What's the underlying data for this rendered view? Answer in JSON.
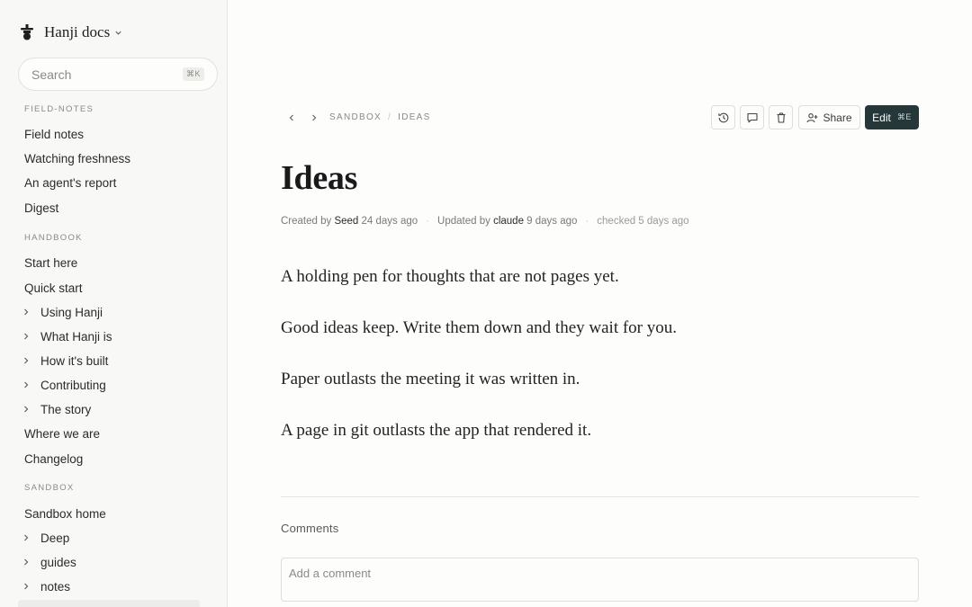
{
  "brand": {
    "title": "Hanji docs",
    "logo_icon": "hanji-logo-icon"
  },
  "search": {
    "placeholder": "Search",
    "shortcut": "⌘K"
  },
  "sidebar": {
    "sections": [
      {
        "title": "FIELD-NOTES",
        "items": [
          {
            "label": "Field notes",
            "expandable": false
          },
          {
            "label": "Watching freshness",
            "expandable": false
          },
          {
            "label": "An agent's report",
            "expandable": false
          },
          {
            "label": "Digest",
            "expandable": false
          }
        ]
      },
      {
        "title": "HANDBOOK",
        "items": [
          {
            "label": "Start here",
            "expandable": false
          },
          {
            "label": "Quick start",
            "expandable": false
          },
          {
            "label": "Using Hanji",
            "expandable": true
          },
          {
            "label": "What Hanji is",
            "expandable": true
          },
          {
            "label": "How it's built",
            "expandable": true
          },
          {
            "label": "Contributing",
            "expandable": true
          },
          {
            "label": "The story",
            "expandable": true
          },
          {
            "label": "Where we are",
            "expandable": false
          },
          {
            "label": "Changelog",
            "expandable": false
          }
        ]
      },
      {
        "title": "SANDBOX",
        "items": [
          {
            "label": "Sandbox home",
            "expandable": false
          },
          {
            "label": "Deep",
            "expandable": true
          },
          {
            "label": "guides",
            "expandable": true
          },
          {
            "label": "notes",
            "expandable": true
          }
        ]
      }
    ]
  },
  "breadcrumb": {
    "items": [
      "SANDBOX",
      "IDEAS"
    ],
    "separator": "/"
  },
  "toolbar": {
    "history_icon": "history-icon",
    "comment_icon": "comment-icon",
    "delete_icon": "trash-icon",
    "share_label": "Share",
    "edit_label": "Edit",
    "edit_shortcut": "⌘E"
  },
  "page": {
    "title": "Ideas",
    "meta": {
      "created_prefix": "Created by",
      "created_by": "Seed",
      "created_ago": "24 days ago",
      "updated_prefix": "Updated by",
      "updated_by": "claude",
      "updated_ago": "9 days ago",
      "checked": "checked 5 days ago"
    },
    "paragraphs": [
      "A holding pen for thoughts that are not pages yet.",
      "Good ideas keep. Write them down and they wait for you.",
      "Paper outlasts the meeting it was written in.",
      "A page in git outlasts the app that rendered it."
    ]
  },
  "comments": {
    "heading": "Comments",
    "placeholder": "Add a comment"
  },
  "colors": {
    "edit_button_bg": "#26373a",
    "sidebar_bg": "#f8f8f6",
    "page_bg": "#fdfdfc"
  }
}
